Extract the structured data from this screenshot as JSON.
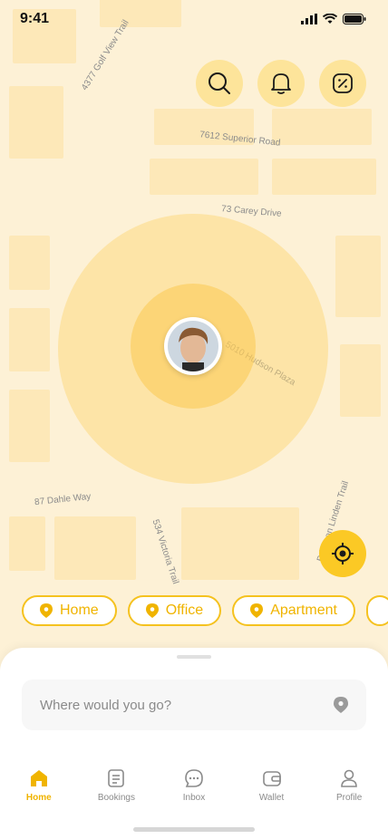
{
  "status_bar": {
    "time": "9:41"
  },
  "map": {
    "road_labels": [
      "4377 Golf View Trail",
      "7612 Superior Road",
      "73 Carey Drive",
      "5010 Hudson Plaza",
      "87 Dahle Way",
      "534 Victoria Trail",
      "Brickson Linden Trail"
    ]
  },
  "top_actions": [
    "search-icon",
    "bell-icon",
    "discount-icon"
  ],
  "colors": {
    "accent": "#fbc925",
    "accent_text": "#f0b400",
    "map_bg": "#fdf1d6"
  },
  "chips": [
    {
      "label": "Home"
    },
    {
      "label": "Office"
    },
    {
      "label": "Apartment"
    }
  ],
  "search": {
    "placeholder": "Where would you go?"
  },
  "tabs": [
    {
      "label": "Home",
      "icon": "home-icon"
    },
    {
      "label": "Bookings",
      "icon": "document-icon"
    },
    {
      "label": "Inbox",
      "icon": "chat-icon"
    },
    {
      "label": "Wallet",
      "icon": "wallet-icon"
    },
    {
      "label": "Profile",
      "icon": "user-icon"
    }
  ]
}
